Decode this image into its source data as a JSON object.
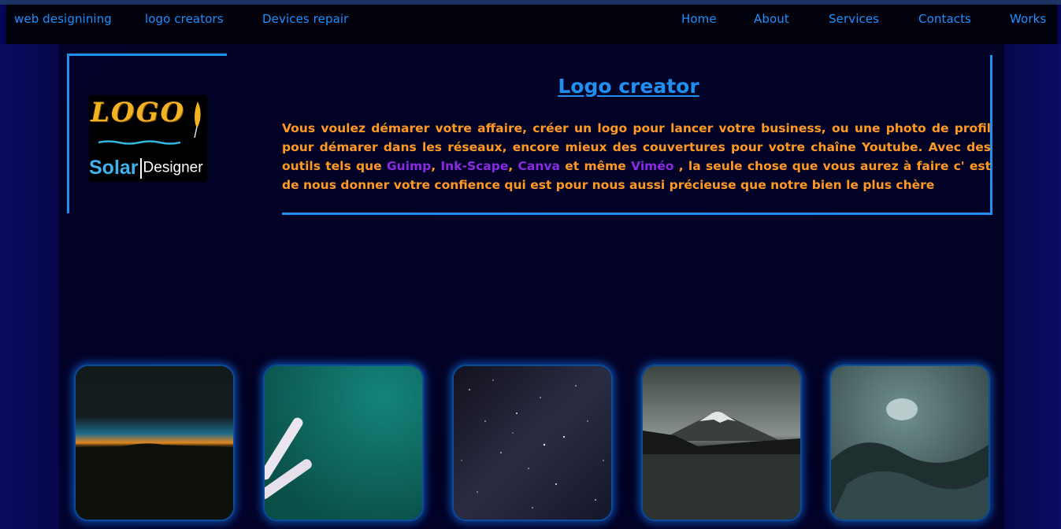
{
  "nav": {
    "left": [
      "web designining",
      "logo creators",
      "Devices repair"
    ],
    "right": [
      "Home",
      "About",
      "Services",
      "Contacts",
      "Works"
    ]
  },
  "logo": {
    "word": "LOGO",
    "brand_solar": "Solar",
    "brand_designer": "Designer"
  },
  "content": {
    "title": "Logo creator",
    "text_1": "Vous voulez démarer votre affaire, créer un logo pour lancer votre business, ou une photo de profil pour démarer dans les réseaux, encore mieux des couvertures pour votre chaîne Youtube. Avec des outils tels que ",
    "tool_1": "Guimp",
    "sep_1": ", ",
    "tool_2": "Ink-Scape",
    "sep_2": ", ",
    "tool_3": "Canva",
    "text_2": " et même ",
    "tool_4": "Viméo",
    "text_3": " , la seule chose que vous aurez à faire c' est de nous donner votre confience qui est pour nous aussi précieuse que notre bien le plus chère"
  },
  "colors": {
    "accent_blue": "#1f8ff0",
    "text_orange": "#ff9922",
    "tool_purple": "#8a2be2",
    "background": "#02022a"
  },
  "gallery": [
    {
      "subject": "sunset-horizon-image"
    },
    {
      "subject": "chalk-on-green-image"
    },
    {
      "subject": "starry-night-sky-image"
    },
    {
      "subject": "mount-fuji-lake-image"
    },
    {
      "subject": "rocky-shore-image"
    }
  ]
}
